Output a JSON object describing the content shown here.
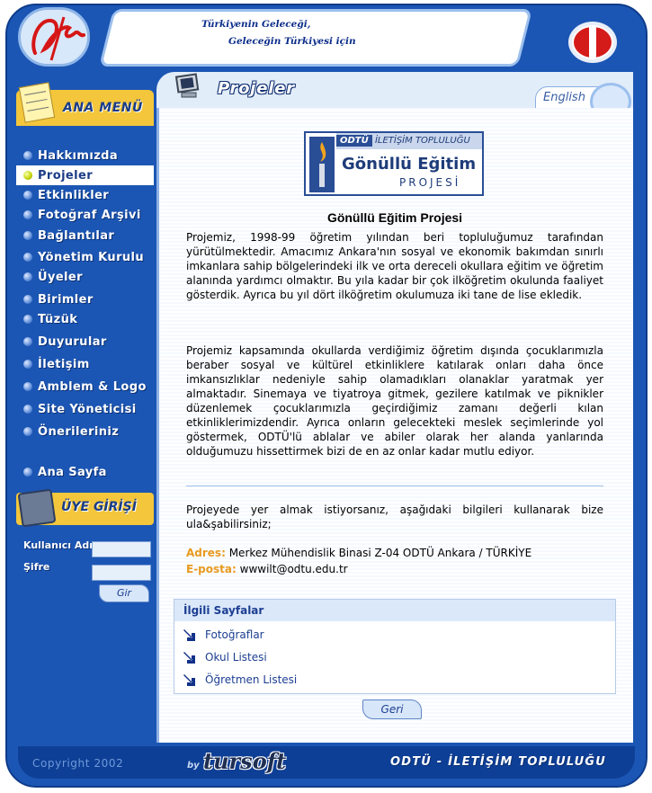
{
  "header": {
    "motto_line1": "Türkiyenin Geleceği,",
    "motto_line2": "Geleceğin Türkiyesi için",
    "page_title": "Projeler",
    "language_link": "English"
  },
  "sidebar": {
    "menu_title": "ANA MENÜ",
    "items": [
      {
        "label": "Hakkımızda"
      },
      {
        "label": "Projeler"
      },
      {
        "label": "Etkinlikler"
      },
      {
        "label": "Fotoğraf Arşivi"
      },
      {
        "label": "Bağlantılar"
      },
      {
        "label": "Yönetim Kurulu"
      },
      {
        "label": "Üyeler"
      },
      {
        "label": "Birimler"
      },
      {
        "label": "Tüzük"
      },
      {
        "label": "Duyurular"
      },
      {
        "label": "İletişim"
      },
      {
        "label": "Amblem & Logo"
      },
      {
        "label": "Site Yöneticisi"
      },
      {
        "label": "Önerileriniz"
      }
    ],
    "home_label": "Ana Sayfa",
    "active_item": "Projeler",
    "login": {
      "title": "ÜYE GİRİŞİ",
      "username_label": "Kullanıcı Adı",
      "password_label": "Şifre",
      "submit_label": "Gir"
    },
    "copyright": "Copyright 2002"
  },
  "project_logo": {
    "org_abbr": "ODTÜ",
    "org_name": "İLETİŞİM TOPLULUĞU",
    "name": "Gönüllü Eğitim",
    "subtitle": "PROJESİ"
  },
  "article": {
    "title": "Gönüllü Eğitim Projesi",
    "paragraphs": [
      "Projemiz, 1998-99 öğretim yılından beri topluluğumuz tarafından yürütülmektedir. Amacımız Ankara'nın sosyal ve ekonomik bakımdan sınırlı imkanlara sahip bölgelerindeki ilk ve orta dereceli okullara eğitim ve öğretim alanında yardımcı olmaktır. Bu yıla kadar bir çok ilköğretim okulunda faaliyet gösterdik. Ayrıca bu yıl dört ilköğretim okulumuza iki tane de lise ekledik.",
      "Projemiz kapsamında okullarda verdiğimiz öğretim dışında çocuklarımızla beraber sosyal ve kültürel etkinliklere katılarak onları daha önce imkansızlıklar nedeniyle sahip olamadıkları olanaklar yaratmak yer almaktadır. Sinemaya ve tiyatroya gitmek, gezilere katılmak ve piknikler düzenlemek çocuklarımızla geçirdiğimiz zamanı değerli kılan etkinliklerimizdendir. Ayrıca onların gelecekteki meslek seçimlerinde yol göstermek, ODTÜ'lü ablalar ve abiler olarak her alanda yanlarında olduğumuzu hissettirmek bizi de en az onlar kadar mutlu ediyor."
    ],
    "cta": "Projeyede yer almak istiyorsanız, aşağıdaki bilgileri kullanarak bize ula&şabilirsiniz;",
    "address_label": "Adres:",
    "address_value": "Merkez Mühendislik Binasi Z-04 ODTÜ Ankara / TÜRKİYE",
    "email_label": "E-posta:",
    "email_value": "wwwilt@odtu.edu.tr"
  },
  "related": {
    "title": "İlgili Sayfalar",
    "links": [
      "Fotoğraflar",
      "Okul Listesi",
      "Öğretmen Listesi"
    ]
  },
  "back_button": "Geri",
  "footer": {
    "by": "by",
    "brand": "tursoft",
    "org": "ODTÜ - İLETİŞİM TOPLULUĞU"
  },
  "colors": {
    "frame_blue": "#1c56b4",
    "menu_yellow": "#f3c63c",
    "accent_orange": "#e89a1f",
    "link_blue": "#1c3e92"
  },
  "icons": {
    "site_logo": "signature-logo-icon",
    "university_logo": "odtu-logo-icon",
    "page_icon": "monitor-icon",
    "menu_bullet": "bullet-dot-icon",
    "related_bullet": "arrow-down-right-icon"
  }
}
